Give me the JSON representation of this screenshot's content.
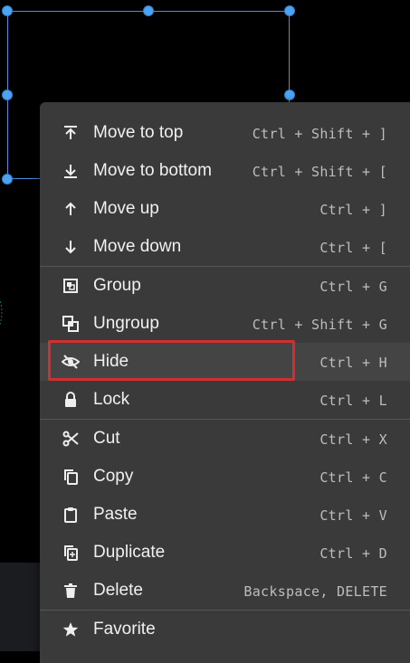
{
  "menu": {
    "items": [
      {
        "label": "Move to top",
        "shortcut": "Ctrl + Shift + ]",
        "icon": "move-to-top-icon"
      },
      {
        "label": "Move to bottom",
        "shortcut": "Ctrl + Shift + [",
        "icon": "move-to-bottom-icon"
      },
      {
        "label": "Move up",
        "shortcut": "Ctrl + ]",
        "icon": "move-up-icon"
      },
      {
        "label": "Move down",
        "shortcut": "Ctrl + [",
        "icon": "move-down-icon"
      },
      {
        "label": "Group",
        "shortcut": "Ctrl + G",
        "icon": "group-icon"
      },
      {
        "label": "Ungroup",
        "shortcut": "Ctrl + Shift + G",
        "icon": "ungroup-icon"
      },
      {
        "label": "Hide",
        "shortcut": "Ctrl + H",
        "icon": "hide-icon"
      },
      {
        "label": "Lock",
        "shortcut": "Ctrl + L",
        "icon": "lock-icon"
      },
      {
        "label": "Cut",
        "shortcut": "Ctrl + X",
        "icon": "cut-icon"
      },
      {
        "label": "Copy",
        "shortcut": "Ctrl + C",
        "icon": "copy-icon"
      },
      {
        "label": "Paste",
        "shortcut": "Ctrl + V",
        "icon": "paste-icon"
      },
      {
        "label": "Duplicate",
        "shortcut": "Ctrl + D",
        "icon": "duplicate-icon"
      },
      {
        "label": "Delete",
        "shortcut": "Backspace, DELETE",
        "icon": "delete-icon"
      },
      {
        "label": "Favorite",
        "shortcut": "",
        "icon": "star-icon"
      }
    ]
  },
  "colors": {
    "canvas_background": "#000000",
    "menu_background": "#3a3a3a",
    "selection_accent": "#4a90e2",
    "highlight": "#d32f2f"
  }
}
